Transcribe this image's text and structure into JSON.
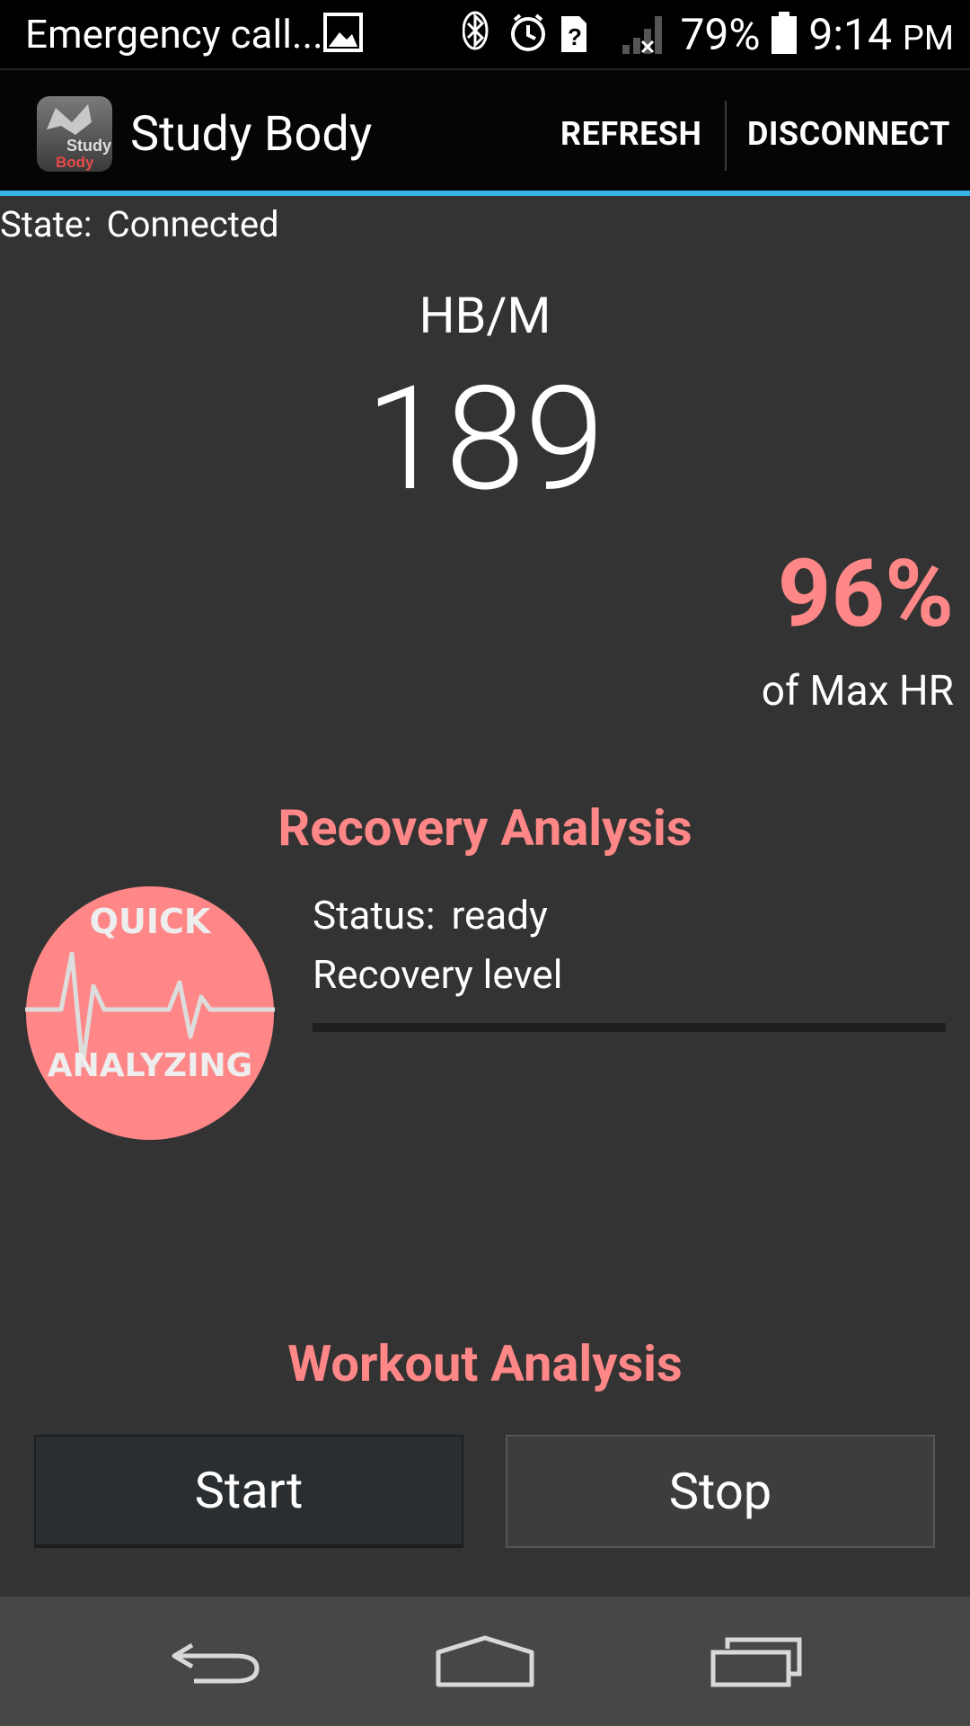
{
  "status_bar": {
    "notification_text": "Emergency call...",
    "battery": "79%",
    "time": "9:14",
    "ampm": "PM",
    "icons": [
      "picture-icon",
      "bluetooth-icon",
      "alarm-icon",
      "sim-unknown-icon",
      "signal-no-service-icon",
      "battery-icon"
    ]
  },
  "action_bar": {
    "title": "Study Body",
    "logo_text_top": "Study",
    "logo_text_bottom": "Body",
    "refresh_label": "REFRESH",
    "disconnect_label": "DISCONNECT"
  },
  "state": {
    "label": "State:",
    "value": "Connected"
  },
  "heart_rate": {
    "unit_label": "HB/M",
    "value": "189",
    "percent": "96%",
    "percent_label": "of Max HR"
  },
  "recovery": {
    "title": "Recovery Analysis",
    "badge_top": "QUICK",
    "badge_bottom": "ANALYZING",
    "status_label": "Status:",
    "status_value": "ready",
    "level_label": "Recovery level",
    "level_progress": 0
  },
  "workout": {
    "title": "Workout Analysis",
    "start_label": "Start",
    "stop_label": "Stop"
  },
  "colors": {
    "accent": "#ff8787",
    "holo_blue": "#33b5e5",
    "background": "#333333"
  },
  "nav_bar": {
    "icons": [
      "back-icon",
      "home-icon",
      "recents-icon"
    ]
  }
}
